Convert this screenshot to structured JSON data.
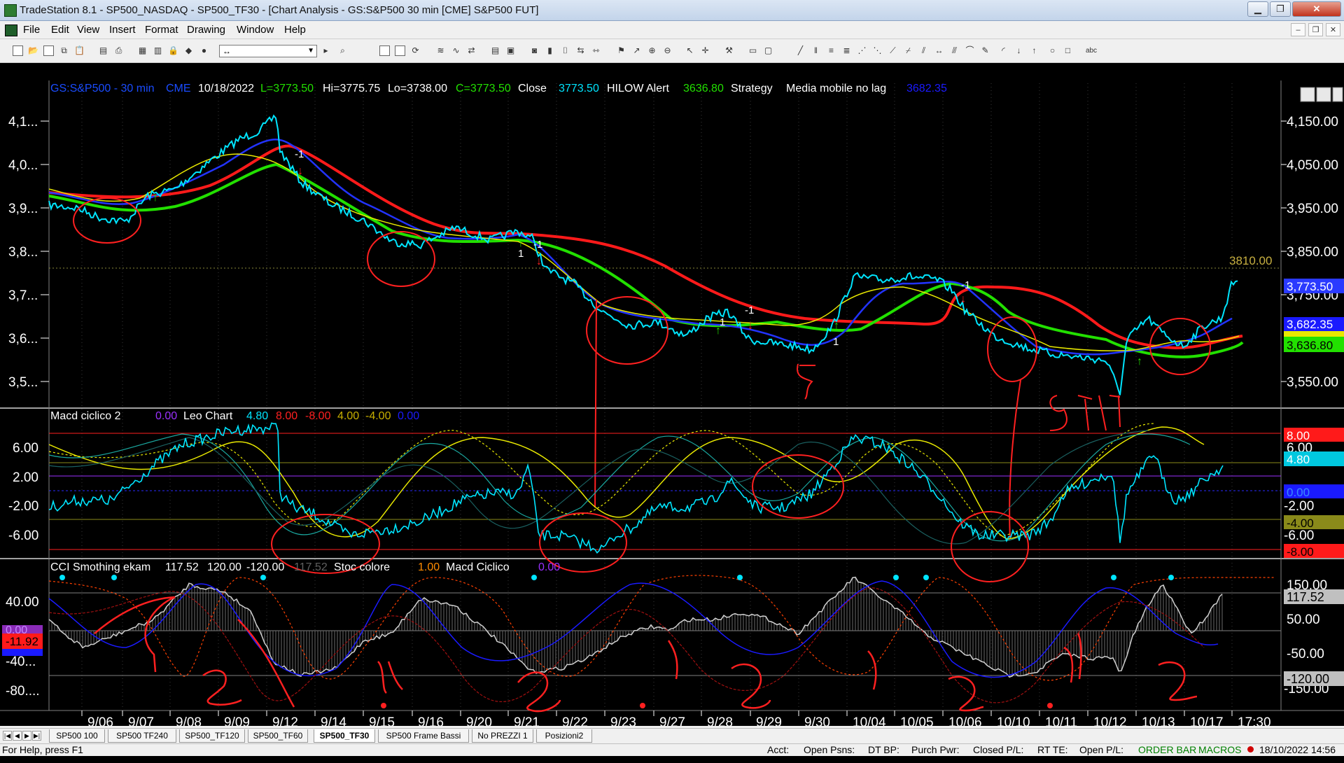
{
  "window": {
    "title": "TradeStation 8.1 - SP500_NASDAQ - SP500_TF30 - [Chart Analysis - GS:S&P500  30 min  [CME] S&P500 FUT]",
    "minimize": "▁",
    "maximize": "❐",
    "close": "✕"
  },
  "menu": {
    "items": [
      "File",
      "Edit",
      "View",
      "Insert",
      "Format",
      "Drawing",
      "Window",
      "Help"
    ],
    "mdi_minimize": "–",
    "mdi_restore": "❐",
    "mdi_close": "✕"
  },
  "toolbar": {
    "drawing_select_value": "↔"
  },
  "chart": {
    "header": {
      "symbol": "GS:S&P500 - 30 min",
      "exchange": "CME",
      "date": "10/18/2022",
      "last": "L=3773.50",
      "high": "Hi=3775.75",
      "low": "Lo=3738.00",
      "close_eq": "C=3773.50",
      "close_label": "Close",
      "close_value": "3773.50",
      "hilow_label": "HILOW Alert",
      "hilow_value": "3636.80",
      "strategy": "Strategy",
      "media_label": "Media mobile no lag",
      "media_value": "3682.35"
    },
    "price_axis_labels": [
      "4,1...",
      "4,0...",
      "3,9...",
      "3,8...",
      "3,7...",
      "3,6...",
      "3,5..."
    ],
    "price_axis_right": [
      "4,150.00",
      "4,050.00",
      "3,950.00",
      "3,850.00",
      "3,750.00",
      "3,650.00",
      "3,550.00"
    ],
    "price_level_3810": "3810.00",
    "price_badges": [
      "3,773.50",
      "3,682.35",
      "3,636.80"
    ],
    "macd_panel": {
      "title": "Macd ciclico 2",
      "values": [
        "0.00",
        "Leo Chart",
        "4.80",
        "8.00",
        "-8.00",
        "4.00",
        "-4.00",
        "0.00"
      ],
      "axis_left": [
        "6.00",
        "2.00",
        "-2.00",
        "-6.00"
      ],
      "axis_right": [
        "6.00",
        "-2.00",
        "-6.00"
      ],
      "badges": [
        "8.00",
        "4.80",
        "0.00",
        "-4.00",
        "-8.00"
      ]
    },
    "cci_panel": {
      "title": "CCI Smothing ekam",
      "values": [
        "117.52",
        "120.00",
        "-120.00",
        "117.52",
        "Stoc colore",
        "1.00",
        "Macd Ciclico",
        "0.00"
      ],
      "axis_left": [
        "40.00",
        "-40...",
        "-80...."
      ],
      "left_badges": [
        "0.00",
        "-11.92"
      ],
      "axis_right": [
        "150.00",
        "50.00",
        "-50.00",
        "-150.00"
      ],
      "badges": [
        "117.52",
        "-120.00"
      ]
    },
    "time_labels": [
      "9/06",
      "9/07",
      "9/08",
      "9/09",
      "9/12",
      "9/14",
      "9/15",
      "9/16",
      "9/20",
      "9/21",
      "9/22",
      "9/23",
      "9/27",
      "9/28",
      "9/29",
      "9/30",
      "10/04",
      "10/05",
      "10/06",
      "10/10",
      "10/11",
      "10/12",
      "10/13",
      "10/17",
      "17:30"
    ],
    "annotations": [
      "-1",
      "-1",
      "1",
      "1",
      "-1",
      "-1",
      "1"
    ]
  },
  "tabs": {
    "items": [
      "SP500 100",
      "SP500 TF240",
      "SP500_TF120",
      "SP500_TF60",
      "SP500_TF30",
      "SP500 Frame Bassi",
      "No PREZZI 1",
      "Posizioni2"
    ],
    "active_index": 4
  },
  "status": {
    "help": "For Help, press F1",
    "acct": "Acct:",
    "open_psns": "Open Psns:",
    "dt_bp": "DT BP:",
    "purch_pwr": "Purch Pwr:",
    "closed_pl": "Closed P/L:",
    "rt_te": "RT TE:",
    "open_pl": "Open P/L:",
    "order_bar": "ORDER BAR",
    "macros": "MACROS",
    "datetime": "18/10/2022 14:56"
  },
  "colors": {
    "price": "#00e5ff",
    "ma_red": "#ff1a1a",
    "ma_green": "#22e000",
    "ma_blue": "#1a1aff",
    "ma_yellow": "#e8e800",
    "annotation": "#ff0000"
  }
}
